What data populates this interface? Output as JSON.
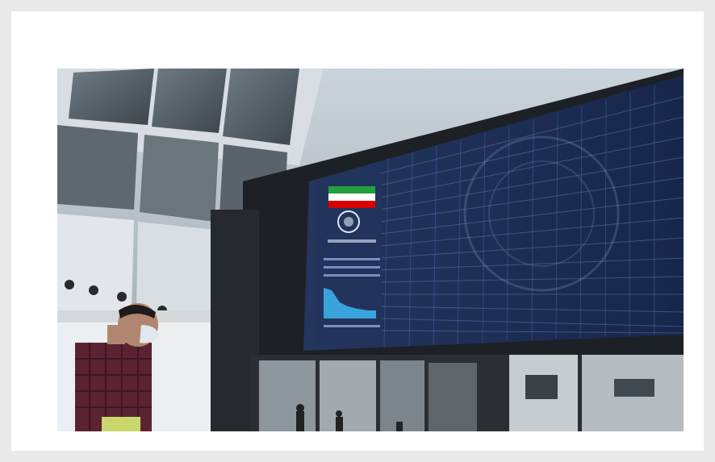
{
  "image": {
    "subject": "stock-exchange-trading-hall-photo",
    "colors": {
      "page_bg": "#e9e9e9",
      "frame_bg": "#ffffff",
      "board_bg": "#1c2b4e",
      "board_grid": "#3d5690",
      "chart_fill": "#3aa3dc",
      "flag_green": "#239f40",
      "flag_red": "#da0000",
      "shirt": "#5a2332",
      "mask": "#dfe8ee"
    }
  }
}
